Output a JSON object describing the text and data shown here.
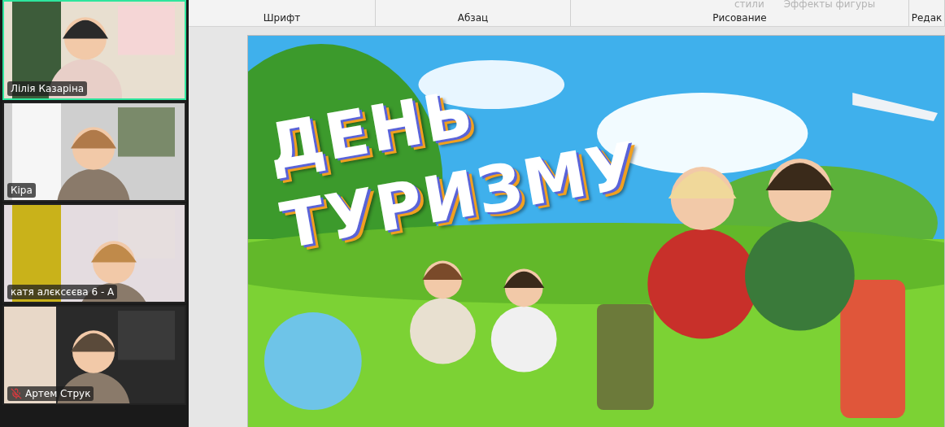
{
  "participants": [
    {
      "name": "Лілія Казаріна",
      "speaking": true,
      "muted": false
    },
    {
      "name": "Кіра",
      "speaking": false,
      "muted": false
    },
    {
      "name": "катя алєксєєва 6 - А",
      "speaking": false,
      "muted": false
    },
    {
      "name": "Артем Струк",
      "speaking": false,
      "muted": true
    }
  ],
  "ribbon": {
    "controls": [
      {
        "label": "стили",
        "disabled": true
      },
      {
        "label": "Эффекты фигуры",
        "disabled": true
      }
    ],
    "groups": [
      "Шрифт",
      "Абзац",
      "Рисование",
      "Редак"
    ]
  },
  "slide": {
    "kind": "picture",
    "title_lines": [
      "ДЕНЬ",
      "ТУРИЗМУ"
    ]
  }
}
